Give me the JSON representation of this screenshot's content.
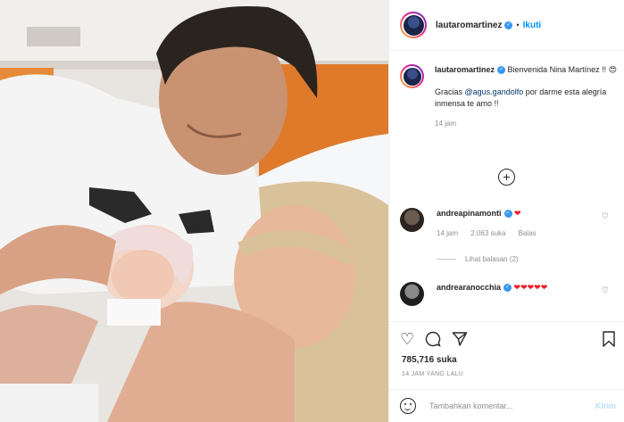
{
  "header": {
    "username": "lautaromartinez",
    "separator": "•",
    "follow_label": "Ikuti"
  },
  "caption": {
    "username": "lautaromartinez",
    "line1": "Bienvenida Nina Martínez !! 😍",
    "gracias": "Gracias",
    "mention": "@agus.gandolfo",
    "rest": "por darme esta alegría inmensa te amo !!",
    "time": "14 jam"
  },
  "comments": [
    {
      "username": "andreapinamonti",
      "text": "❤",
      "time": "14 jam",
      "likes": "2.063 suka",
      "reply": "Balas",
      "view_replies": "Lihat balasan (2)"
    },
    {
      "username": "andrearanocchia",
      "text": "❤❤❤❤❤"
    }
  ],
  "actions": {
    "like_icon": "heart-outline",
    "comment_icon": "comment-bubble",
    "share_icon": "paper-plane",
    "save_icon": "bookmark",
    "likes": "785,716 suka",
    "timestamp": "14 JAM YANG LALU"
  },
  "add_comment": {
    "placeholder": "Tambahkan komentar...",
    "post_label": "Kirim"
  },
  "colors": {
    "accent": "#0095f6",
    "verified": "#3897f0",
    "heart": "#ed1c24"
  }
}
